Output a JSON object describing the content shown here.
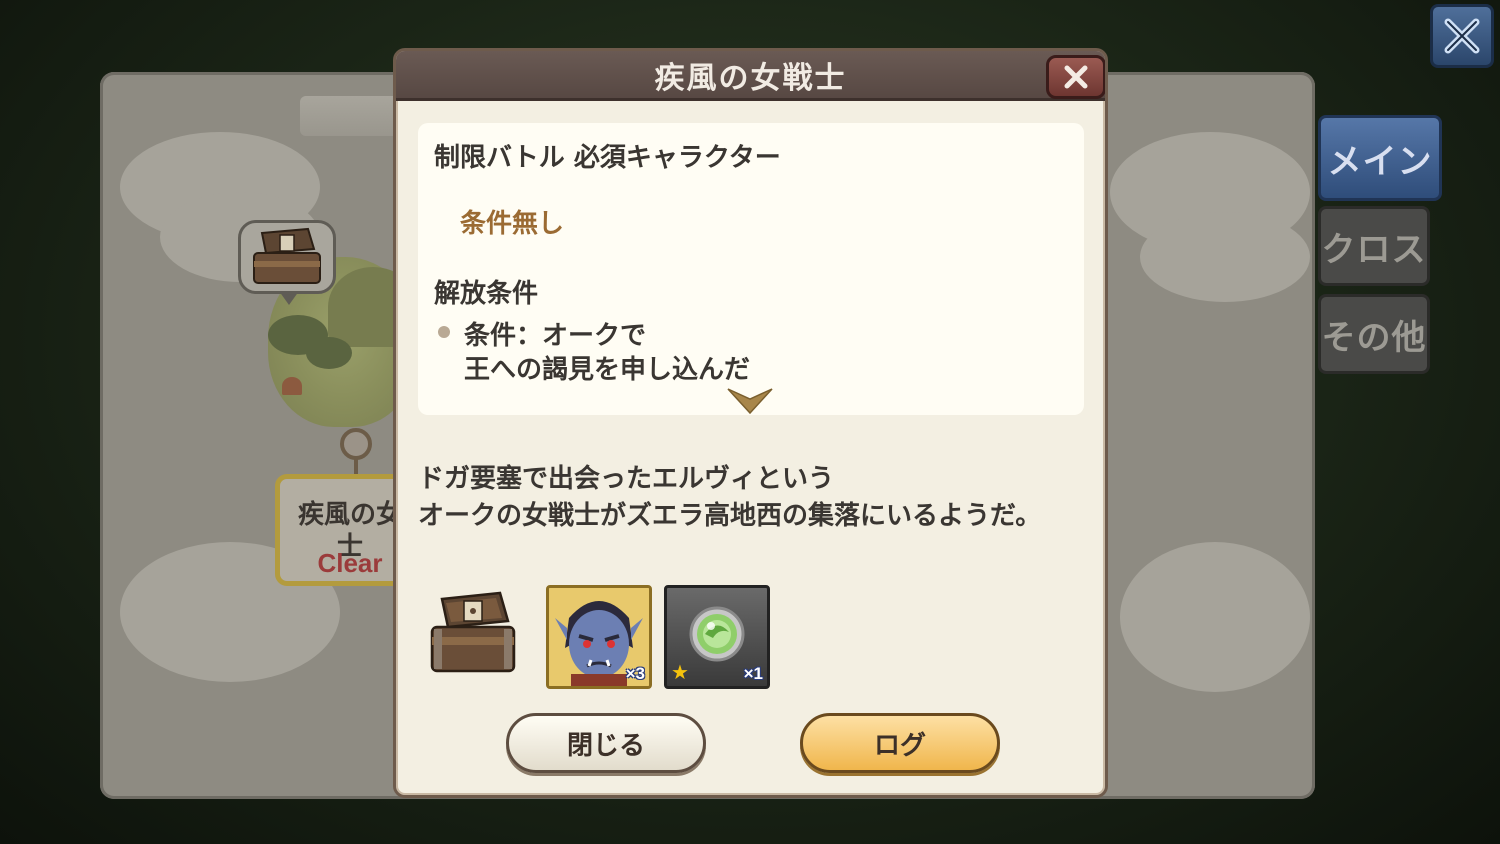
{
  "map": {
    "node_title": "疾風の女士",
    "node_status": "Clear"
  },
  "outer_close": {
    "icon": "close-icon"
  },
  "side_tabs": [
    {
      "label": "メイン",
      "active": true
    },
    {
      "label": "クロス",
      "active": false
    },
    {
      "label": "その他",
      "active": false
    }
  ],
  "dialog": {
    "title": "疾風の女戦士",
    "close_icon": "close-icon",
    "restriction_label": "制限バトル 必須キャラクター",
    "restriction_value": "条件無し",
    "unlock_label": "解放条件",
    "unlock_line1": "条件：オークで",
    "unlock_line2": "王への謁見を申し込んだ",
    "description_line1": "ドガ要塞で出会ったエルヴィという",
    "description_line2": "オークの女戦士がズエラ高地西の集落にいるようだ。",
    "rewards": [
      {
        "kind": "treasure-chest",
        "quantity": ""
      },
      {
        "kind": "character-portrait",
        "quantity": "×3"
      },
      {
        "kind": "green-orb",
        "quantity": "×1",
        "rarity_stars": 1
      }
    ],
    "buttons": {
      "close_label": "閉じる",
      "log_label": "ログ"
    }
  },
  "colors": {
    "dialog_bg": "#f3efe2",
    "header_bg": "#5f4f4a",
    "accent_condition": "#9b6b33",
    "tab_active": "#3f5f8f",
    "log_button": "#f0b64c"
  }
}
